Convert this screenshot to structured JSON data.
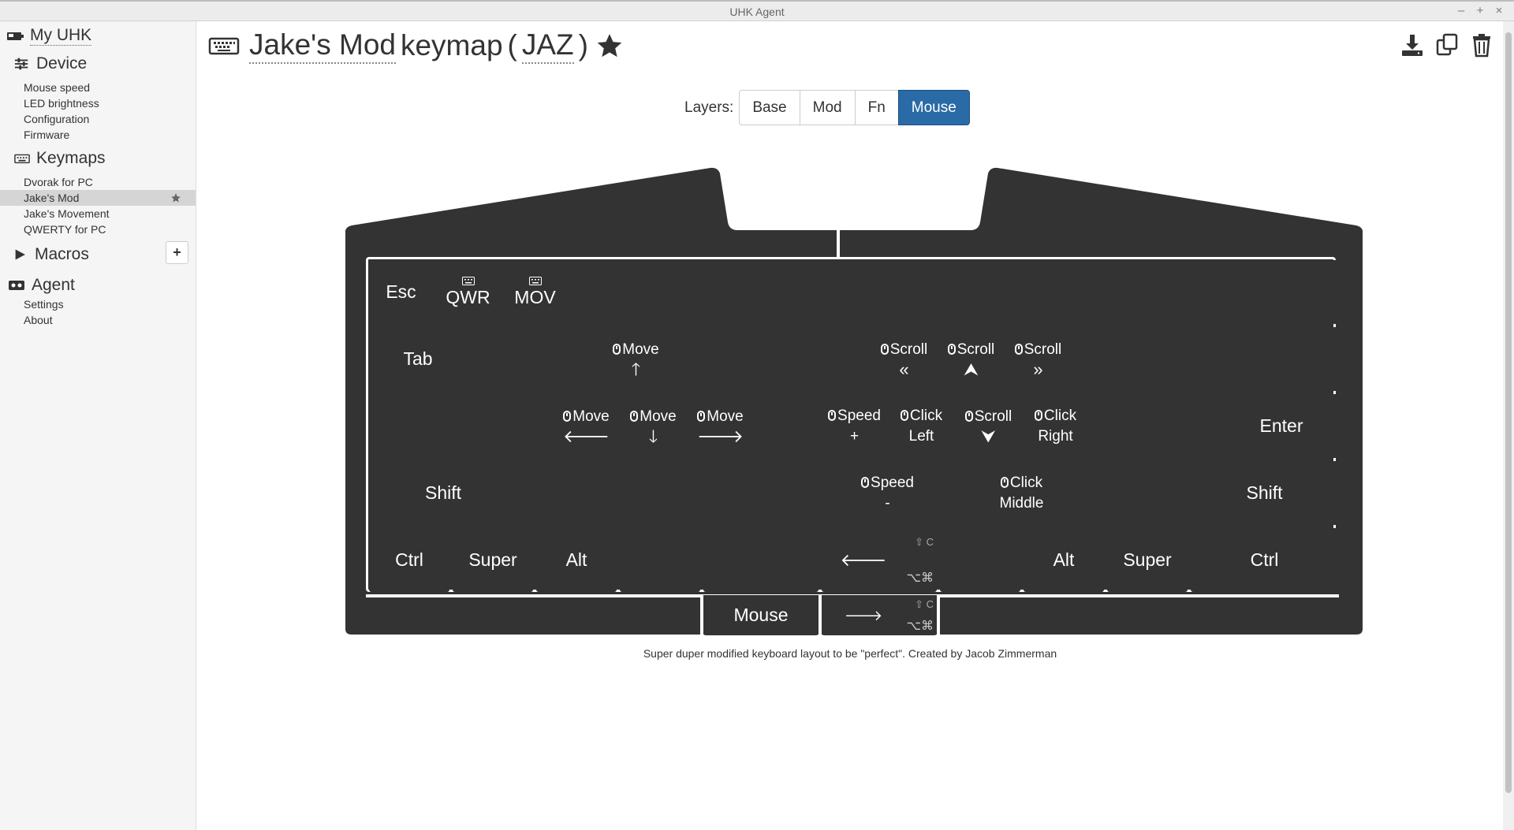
{
  "window": {
    "title": "UHK Agent",
    "controls": [
      "–",
      "+",
      "×"
    ]
  },
  "sidebar": {
    "my_uhk": "My UHK",
    "device": {
      "label": "Device",
      "items": [
        "Mouse speed",
        "LED brightness",
        "Configuration",
        "Firmware"
      ]
    },
    "keymaps": {
      "label": "Keymaps",
      "items": [
        "Dvorak for PC",
        "Jake's Mod",
        "Jake's Movement",
        "QWERTY for PC"
      ],
      "selected": "Jake's Mod"
    },
    "macros": {
      "label": "Macros",
      "add_label": "+"
    },
    "agent": {
      "label": "Agent",
      "items": [
        "Settings",
        "About"
      ]
    }
  },
  "header": {
    "keymap_name": "Jake's Mod",
    "keymap_word": "keymap",
    "open_paren": "(",
    "abbreviation": "JAZ",
    "close_paren": ")"
  },
  "layers": {
    "label": "Layers:",
    "options": [
      "Base",
      "Mod",
      "Fn",
      "Mouse"
    ],
    "active": "Mouse"
  },
  "keys": {
    "esc": "Esc",
    "qwr": "QWR",
    "mov": "MOV",
    "tab": "Tab",
    "move": "Move",
    "scroll": "Scroll",
    "speed": "Speed",
    "click": "Click",
    "plus": "+",
    "minus": "-",
    "left": "Left",
    "right": "Right",
    "middle": "Middle",
    "enter": "Enter",
    "shift": "Shift",
    "ctrl": "Ctrl",
    "super": "Super",
    "alt": "Alt",
    "mouse": "Mouse",
    "mod_top": "⇧ C",
    "mod_bottom": "⌥⌘"
  },
  "description": "Super duper modified keyboard layout to be \"perfect\". Created by Jacob Zimmerman",
  "colors": {
    "accent": "#2a6aa6",
    "key": "#333333",
    "board": "#333333",
    "sidebar_bg": "#f5f5f5",
    "selected_bg": "#d5d5d5"
  }
}
